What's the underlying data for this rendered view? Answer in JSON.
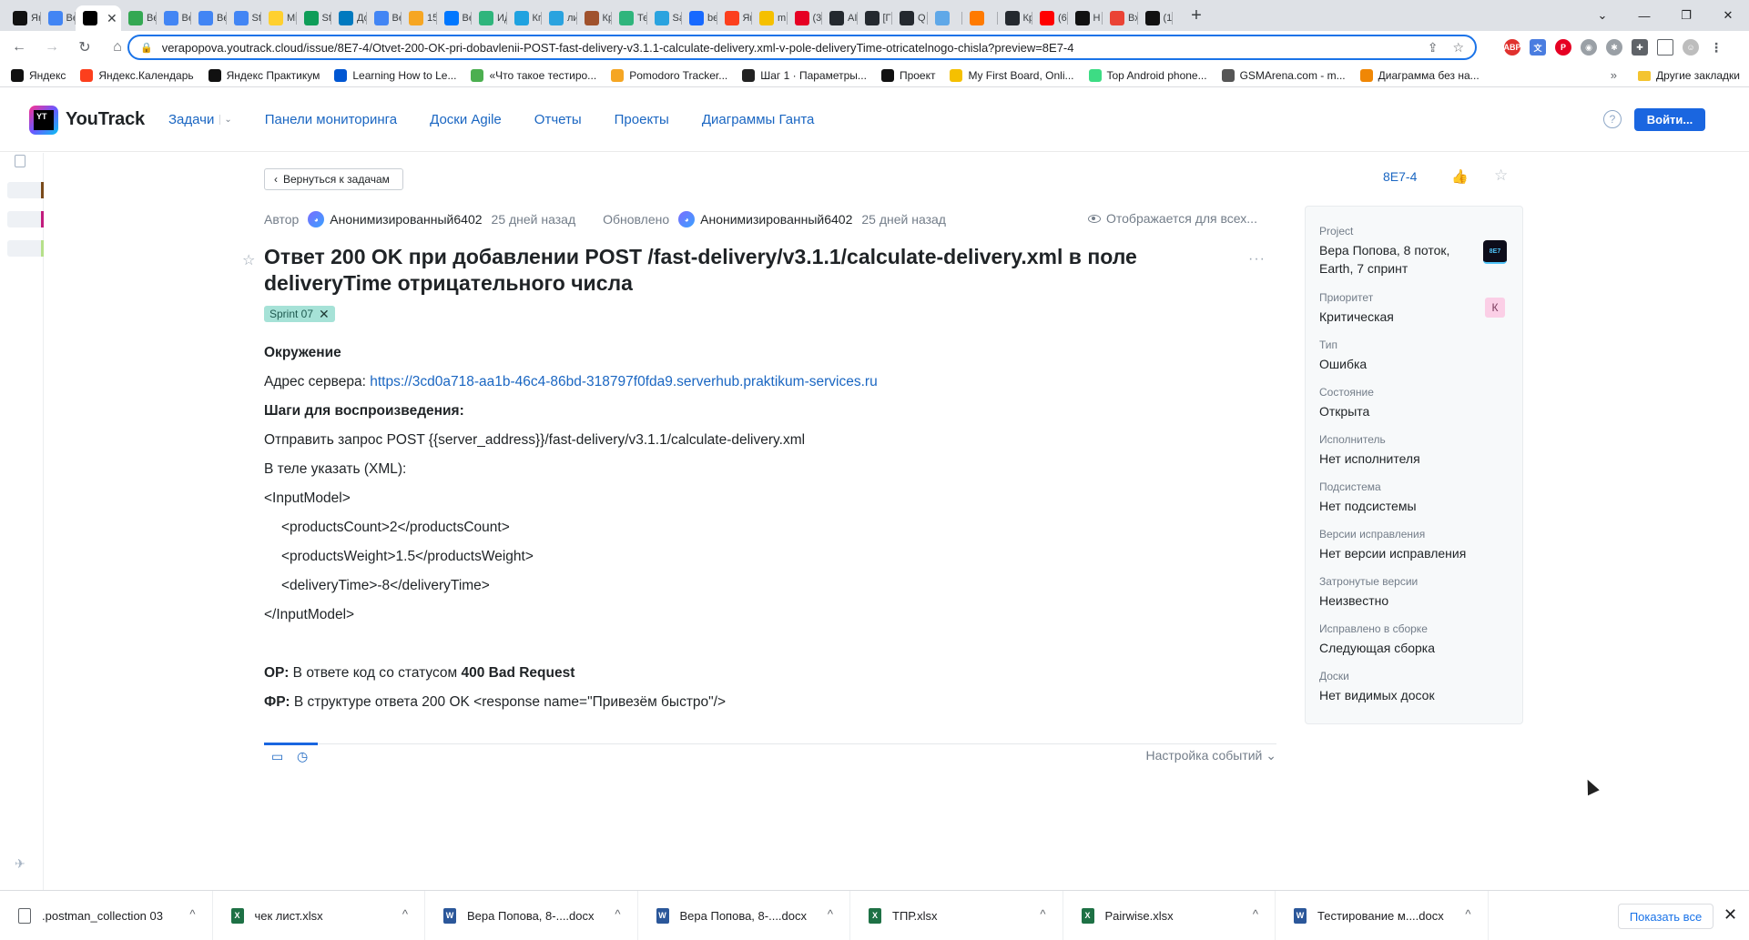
{
  "browser": {
    "tabs": [
      {
        "label": "Ян",
        "icon": "yandex-practicum-icon",
        "color": "#111111"
      },
      {
        "label": "Ве",
        "icon": "google-docs-icon",
        "color": "#4285f4"
      },
      {
        "label": "",
        "icon": "youtrack-icon",
        "color": "#000000",
        "active": true
      },
      {
        "label": "Ве",
        "icon": "google-drive-icon",
        "color": "#34a853"
      },
      {
        "label": "Ве",
        "icon": "google-docs-icon",
        "color": "#4285f4"
      },
      {
        "label": "Ве",
        "icon": "google-docs-icon",
        "color": "#4285f4"
      },
      {
        "label": "St",
        "icon": "google-docs-icon",
        "color": "#4285f4"
      },
      {
        "label": "Mi",
        "icon": "miro-icon",
        "color": "#ffd02f"
      },
      {
        "label": "St",
        "icon": "google-sheets-icon",
        "color": "#0f9d58"
      },
      {
        "label": "До",
        "icon": "trello-icon",
        "color": "#0079bf"
      },
      {
        "label": "Ве",
        "icon": "google-docs-icon",
        "color": "#4285f4"
      },
      {
        "label": "15",
        "icon": "mail-icon",
        "color": "#f6a623"
      },
      {
        "label": "Ве",
        "icon": "vk-icon",
        "color": "#0077ff"
      },
      {
        "label": "Ид",
        "icon": "app-icon",
        "color": "#2fb57c"
      },
      {
        "label": "Кг",
        "icon": "globe-icon",
        "color": "#1fa2e0"
      },
      {
        "label": "ли",
        "icon": "telegram-icon",
        "color": "#2aa3df"
      },
      {
        "label": "Кр",
        "icon": "book-icon",
        "color": "#a0522d"
      },
      {
        "label": "Те",
        "icon": "app-icon",
        "color": "#2fb57c"
      },
      {
        "label": "Sa",
        "icon": "telegram-icon",
        "color": "#2aa3df"
      },
      {
        "label": "be",
        "icon": "behance-icon",
        "color": "#1769ff"
      },
      {
        "label": "Ян",
        "icon": "calendar-icon",
        "color": "#fc3f1d"
      },
      {
        "label": "m",
        "icon": "chart-icon",
        "color": "#f5c000"
      },
      {
        "label": "(3",
        "icon": "pinterest-icon",
        "color": "#e60023"
      },
      {
        "label": "AI",
        "icon": "github-icon",
        "color": "#24292f"
      },
      {
        "label": "[Г",
        "icon": "github-icon",
        "color": "#24292f"
      },
      {
        "label": "Q",
        "icon": "github-icon",
        "color": "#24292f"
      },
      {
        "label": "",
        "icon": "cloud-icon",
        "color": "#5fa8e8"
      },
      {
        "label": "",
        "icon": "fire-icon",
        "color": "#ff7a00"
      },
      {
        "label": "Кр",
        "icon": "github-icon",
        "color": "#24292f"
      },
      {
        "label": "(6",
        "icon": "youtube-icon",
        "color": "#ff0000"
      },
      {
        "label": "Н",
        "icon": "habr-icon",
        "color": "#111111"
      },
      {
        "label": "Вх",
        "icon": "gmail-icon",
        "color": "#ea4335"
      },
      {
        "label": "(1",
        "icon": "notion-icon",
        "color": "#111111"
      }
    ],
    "new_tab": "+",
    "url": "verapopova.youtrack.cloud/issue/8E7-4/Otvet-200-OK-pri-dobavlenii-POST-fast-delivery-v3.1.1-calculate-delivery.xml-v-pole-deliveryTime-otricatelnogo-chisla?preview=8E7-4",
    "bookmarks": [
      {
        "label": "Яндекс",
        "icon": "yandex-icon",
        "color": "#111111"
      },
      {
        "label": "Яндекс.Календарь",
        "icon": "calendar-icon",
        "color": "#fc3f1d"
      },
      {
        "label": "Яндекс Практикум",
        "icon": "practicum-icon",
        "color": "#111111"
      },
      {
        "label": "Learning How to Le...",
        "icon": "coursera-icon",
        "color": "#0056d2"
      },
      {
        "label": "«Что такое тестиро...",
        "icon": "leaf-icon",
        "color": "#4caf50"
      },
      {
        "label": "Pomodoro Tracker...",
        "icon": "tomato-icon",
        "color": "#f5a623"
      },
      {
        "label": "Шаг 1 · Параметры...",
        "icon": "circle-icon",
        "color": "#222222"
      },
      {
        "label": "Проект",
        "icon": "youtrack-icon",
        "color": "#111111"
      },
      {
        "label": "My First Board, Onli...",
        "icon": "miro-icon",
        "color": "#f5c000"
      },
      {
        "label": "Top Android phone...",
        "icon": "android-icon",
        "color": "#3ddc84"
      },
      {
        "label": "GSMArena.com - m...",
        "icon": "gsm-icon",
        "color": "#555555"
      },
      {
        "label": "Диаграмма без на...",
        "icon": "diagram-icon",
        "color": "#f08705"
      }
    ],
    "bookmarks_more": "»",
    "other_bookmarks": "Другие закладки"
  },
  "header": {
    "logo": "YouTrack",
    "logo_mark": "YT",
    "nav": [
      "Задачи",
      "Панели мониторинга",
      "Доски Agile",
      "Отчеты",
      "Проекты",
      "Диаграммы Ганта"
    ],
    "help": "?",
    "login": "Войти..."
  },
  "issue": {
    "back": "Вернуться к задачам",
    "id": "8E7-4",
    "author_label": "Автор",
    "author": "Анонимизированный6402",
    "created_ago": "25 дней назад",
    "updated_label": "Обновлено",
    "updater": "Анонимизированный6402",
    "updated_ago": "25 дней назад",
    "visibility": "Отображается для всех...",
    "title": "Ответ 200 OK при добавлении POST /fast-delivery/v3.1.1/calculate-delivery.xml в поле deliveryTime отрицательного числа",
    "tag": "Sprint 07",
    "description": {
      "env_heading": "Окружение",
      "server_label": "Адрес сервера:",
      "server_url": "https://3cd0a718-aa1b-46c4-86bd-318797f0fda9.serverhub.praktikum-services.ru",
      "steps_heading": "Шаги для воспроизведения:",
      "step1": "Отправить запрос POST {{server_address}}/fast-delivery/v3.1.1/calculate-delivery.xml",
      "step2": "В теле указать (XML):",
      "xml_open": "<InputModel>",
      "xml_count": "<productsCount>2</productsCount>",
      "xml_weight": "<productsWeight>1.5</productsWeight>",
      "xml_time": "<deliveryTime>-8</deliveryTime>",
      "xml_close": "</InputModel>",
      "expected_label": "ОР:",
      "expected_text": "В ответе код со статусом",
      "expected_code": "400 Bad Request",
      "actual_label": "ФР:",
      "actual_text": "В структуре ответа 200 OK <response name=\"Привезём быстро\"/>"
    },
    "event_settings": "Настройка событий"
  },
  "fields": {
    "project": {
      "label": "Project",
      "value": "Вера Попова, 8 поток, Earth, 7 спринт",
      "badge": "8E7"
    },
    "priority": {
      "label": "Приоритет",
      "value": "Критическая",
      "badge": "К"
    },
    "type": {
      "label": "Тип",
      "value": "Ошибка"
    },
    "state": {
      "label": "Состояние",
      "value": "Открыта"
    },
    "assignee": {
      "label": "Исполнитель",
      "value": "Нет исполнителя"
    },
    "subsystem": {
      "label": "Подсистема",
      "value": "Нет подсистемы"
    },
    "fix_versions": {
      "label": "Версии исправления",
      "value": "Нет версии исправления"
    },
    "affected_versions": {
      "label": "Затронутые версии",
      "value": "Неизвестно"
    },
    "fixed_in_build": {
      "label": "Исправлено в сборке",
      "value": "Следующая сборка"
    },
    "boards": {
      "label": "Доски",
      "value": "Нет видимых досок"
    }
  },
  "downloads": {
    "items": [
      {
        "name": ".postman_collection 03",
        "type": "doc"
      },
      {
        "name": "чек лист.xlsx",
        "type": "xls"
      },
      {
        "name": "Вера Попова, 8-....docx",
        "type": "word"
      },
      {
        "name": "Вера Попова, 8-....docx",
        "type": "word"
      },
      {
        "name": "ТПР.xlsx",
        "type": "xls"
      },
      {
        "name": "Pairwise.xlsx",
        "type": "xls"
      },
      {
        "name": "Тестирование м....docx",
        "type": "word"
      }
    ],
    "show_all": "Показать все"
  },
  "colors": {
    "accent": "#1a66c2",
    "button": "#1a66e0",
    "tag_bg": "#a6e2d7",
    "priority_bg": "#fbcfe6"
  }
}
